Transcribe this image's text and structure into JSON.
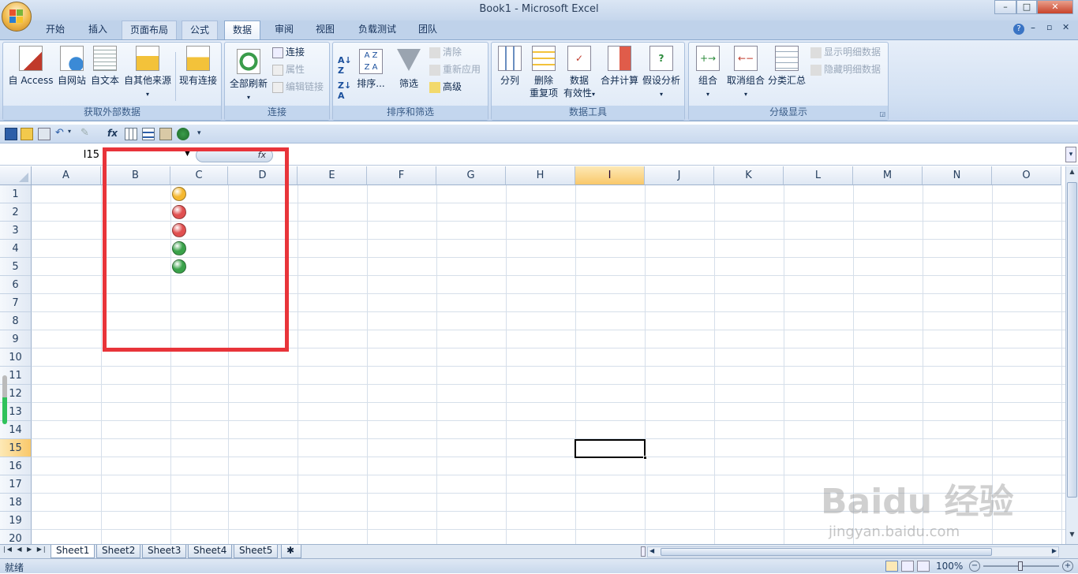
{
  "window": {
    "title": "Book1 - Microsoft Excel"
  },
  "tabs": [
    {
      "label": "开始"
    },
    {
      "label": "插入"
    },
    {
      "label": "页面布局"
    },
    {
      "label": "公式"
    },
    {
      "label": "数据"
    },
    {
      "label": "审阅"
    },
    {
      "label": "视图"
    },
    {
      "label": "负载测试"
    },
    {
      "label": "团队"
    }
  ],
  "ribbon": {
    "groups": {
      "external": {
        "label": "获取外部数据",
        "buttons": [
          "自 Access",
          "自网站",
          "自文本",
          "自其他来源",
          "现有连接"
        ]
      },
      "connections": {
        "label": "连接",
        "refresh": "全部刷新",
        "small": [
          "连接",
          "属性",
          "编辑链接"
        ]
      },
      "sort": {
        "label": "排序和筛选",
        "sort": "排序...",
        "filter": "筛选",
        "small": [
          "清除",
          "重新应用",
          "高级"
        ]
      },
      "tools": {
        "label": "数据工具",
        "buttons": [
          "分列",
          "删除",
          "重复项",
          "数据",
          "有效性",
          "合并计算",
          "假设分析"
        ]
      },
      "outline": {
        "label": "分级显示",
        "buttons": [
          "组合",
          "取消组合",
          "分类汇总"
        ],
        "small": [
          "显示明细数据",
          "隐藏明细数据"
        ]
      }
    }
  },
  "formula": {
    "name_box": "I15",
    "fx": "fx"
  },
  "columns": [
    "A",
    "B",
    "C",
    "D",
    "E",
    "F",
    "G",
    "H",
    "I",
    "J",
    "K",
    "L",
    "M",
    "N",
    "O"
  ],
  "rows": [
    "1",
    "2",
    "3",
    "4",
    "5",
    "6",
    "7",
    "8",
    "9",
    "10",
    "11",
    "12",
    "13",
    "14",
    "15",
    "16",
    "17",
    "18",
    "19",
    "20"
  ],
  "selected_cell": {
    "column": "I",
    "row": "15"
  },
  "icons_in_column_c": [
    {
      "row": 1,
      "color": "#f5b830"
    },
    {
      "row": 2,
      "color": "#e05050"
    },
    {
      "row": 3,
      "color": "#e05050"
    },
    {
      "row": 4,
      "color": "#3aa24a"
    },
    {
      "row": 5,
      "color": "#3aa24a"
    }
  ],
  "sheets": [
    "Sheet1",
    "Sheet2",
    "Sheet3",
    "Sheet4",
    "Sheet5"
  ],
  "status": {
    "mode": "就绪",
    "zoom": "100%"
  },
  "watermark": {
    "brand": "Baidu 经验",
    "url": "jingyan.baidu.com"
  }
}
